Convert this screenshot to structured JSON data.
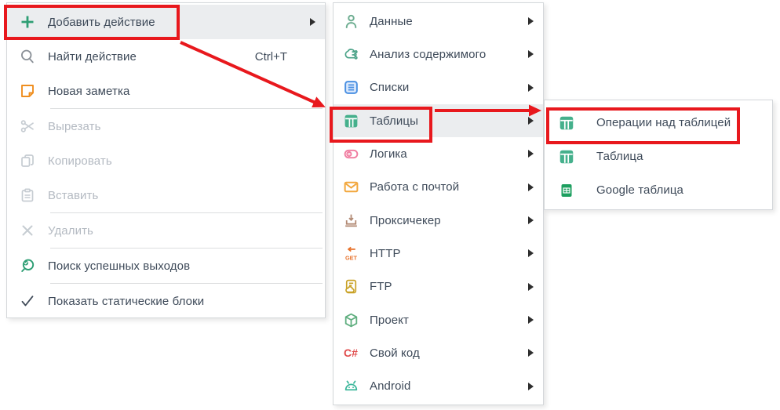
{
  "palette": {
    "annotation_red": "#e8181d",
    "menu_text": "#3e4a59",
    "disabled_text": "#b4bac2",
    "disabled_icon": "#c6ccd2",
    "green": "#2e9e74",
    "table_green": "#45b08c",
    "soft_green": "#6fae92",
    "analysis_teal": "#4aa287",
    "list_blue": "#4a90e2",
    "logic_pink": "#f07ca0",
    "mail_orange": "#f2a73d",
    "proxy_tan": "#b28a74",
    "http_orange": "#e8732c",
    "ftp_gold": "#c9a227",
    "cube_green": "#5fae7f",
    "csharp_red": "#e04b4b",
    "android_teal": "#3cb79b",
    "sheets_green": "#1d9f5f",
    "note_orange": "#ef8e1f",
    "hover_bg": "#ebedef",
    "panel_border": "#d4d7da"
  },
  "context_menu": {
    "items": [
      {
        "label": "Добавить действие",
        "icon": "plus-icon",
        "has_submenu": true,
        "highlighted": true,
        "annotated": true
      },
      {
        "label": "Найти действие",
        "shortcut": "Ctrl+T",
        "icon": "search-icon"
      },
      {
        "label": "Новая заметка",
        "icon": "note-icon"
      },
      {
        "label": "Вырезать",
        "icon": "scissors-icon",
        "disabled": true
      },
      {
        "label": "Копировать",
        "icon": "copy-icon",
        "disabled": true
      },
      {
        "label": "Вставить",
        "icon": "paste-icon",
        "disabled": true
      },
      {
        "label": "Удалить",
        "icon": "delete-icon",
        "disabled": true
      },
      {
        "label": "Поиск успешных выходов",
        "icon": "search-check-icon"
      },
      {
        "label": "Показать статические блоки",
        "icon": "check-icon"
      }
    ]
  },
  "actions_submenu": {
    "items": [
      {
        "label": "Данные",
        "icon": "person-icon",
        "has_submenu": true
      },
      {
        "label": "Анализ содержимого",
        "icon": "analysis-icon",
        "has_submenu": true
      },
      {
        "label": "Списки",
        "icon": "list-icon",
        "has_submenu": true
      },
      {
        "label": "Таблицы",
        "icon": "table-icon",
        "has_submenu": true,
        "highlighted": true,
        "annotated": true
      },
      {
        "label": "Логика",
        "icon": "toggle-icon",
        "has_submenu": true
      },
      {
        "label": "Работа с почтой",
        "icon": "mail-icon",
        "has_submenu": true
      },
      {
        "label": "Проксичекер",
        "icon": "proxy-icon",
        "has_submenu": true
      },
      {
        "label": "HTTP",
        "icon": "http-get-icon",
        "icon_text": "GET",
        "has_submenu": true
      },
      {
        "label": "FTP",
        "icon": "ftp-icon",
        "has_submenu": true
      },
      {
        "label": "Проект",
        "icon": "cube-icon",
        "has_submenu": true
      },
      {
        "label": "Свой код",
        "icon": "csharp-icon",
        "icon_text": "C#",
        "has_submenu": true
      },
      {
        "label": "Android",
        "icon": "android-icon",
        "has_submenu": true
      }
    ]
  },
  "tables_submenu": {
    "items": [
      {
        "label": "Операции над таблицей",
        "icon": "table-icon",
        "annotated": true
      },
      {
        "label": "Таблица",
        "icon": "table-icon"
      },
      {
        "label": "Google таблица",
        "icon": "google-sheets-icon"
      }
    ]
  }
}
